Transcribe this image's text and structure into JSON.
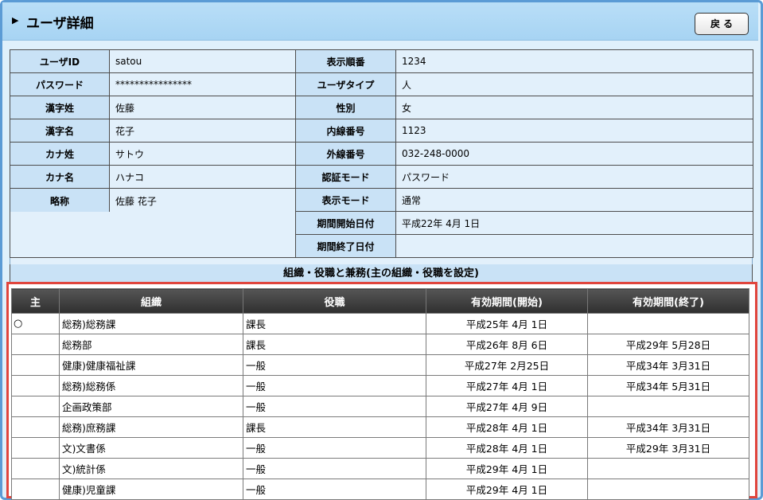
{
  "header": {
    "title": "ユーザ詳細",
    "arrow": "▶",
    "back_label": "戻る"
  },
  "info_rows": [
    {
      "l1": "ユーザID",
      "v1": "satou",
      "l2": "表示順番",
      "v2": "1234"
    },
    {
      "l1": "パスワード",
      "v1": "****************",
      "l2": "ユーザタイプ",
      "v2": "人"
    },
    {
      "l1": "漢字姓",
      "v1": "佐藤",
      "l2": "性別",
      "v2": "女"
    },
    {
      "l1": "漢字名",
      "v1": "花子",
      "l2": "内線番号",
      "v2": "1123"
    },
    {
      "l1": "カナ姓",
      "v1": "サトウ",
      "l2": "外線番号",
      "v2": "032-248-0000"
    },
    {
      "l1": "カナ名",
      "v1": "ハナコ",
      "l2": "認証モード",
      "v2": "パスワード"
    },
    {
      "l1": "略称",
      "v1": "佐藤 花子",
      "l2": "表示モード",
      "v2": "通常"
    },
    {
      "l1": "",
      "v1": "",
      "l2": "期間開始日付",
      "v2": "平成22年 4月 1日"
    },
    {
      "l1": "",
      "v1": "",
      "l2": "期間終了日付",
      "v2": ""
    }
  ],
  "org_section": {
    "title": "組織・役職と兼務(主の組織・役職を設定)",
    "headers": [
      "主",
      "組織",
      "役職",
      "有効期間(開始)",
      "有効期間(終了)"
    ],
    "rows": [
      {
        "main": "○",
        "org": "総務)総務課",
        "post": "課長",
        "start": "平成25年 4月 1日",
        "end": ""
      },
      {
        "main": "",
        "org": "総務部",
        "post": "課長",
        "start": "平成26年 8月 6日",
        "end": "平成29年 5月28日"
      },
      {
        "main": "",
        "org": "健康)健康福祉課",
        "post": "一般",
        "start": "平成27年 2月25日",
        "end": "平成34年 3月31日"
      },
      {
        "main": "",
        "org": "総務)総務係",
        "post": "一般",
        "start": "平成27年 4月 1日",
        "end": "平成34年 5月31日"
      },
      {
        "main": "",
        "org": "企画政策部",
        "post": "一般",
        "start": "平成27年 4月 9日",
        "end": ""
      },
      {
        "main": "",
        "org": "総務)庶務課",
        "post": "課長",
        "start": "平成28年 4月 1日",
        "end": "平成34年 3月31日"
      },
      {
        "main": "",
        "org": "文)文書係",
        "post": "一般",
        "start": "平成28年 4月 1日",
        "end": "平成29年 3月31日"
      },
      {
        "main": "",
        "org": "文)統計係",
        "post": "一般",
        "start": "平成29年 4月 1日",
        "end": ""
      },
      {
        "main": "",
        "org": "健康)児童課",
        "post": "一般",
        "start": "平成29年 4月 1日",
        "end": ""
      }
    ]
  },
  "colors": {
    "accent": "#5b9bd5",
    "highlight": "#e0453d",
    "label_bg": "#c9e2f6",
    "value_bg": "#e2f0fb",
    "header_bg": "#333333"
  }
}
